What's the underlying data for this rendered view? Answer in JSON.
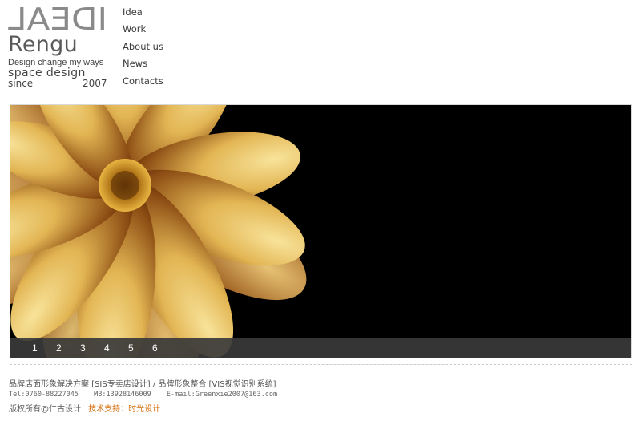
{
  "logo": {
    "ideal": "IDEAL",
    "name": "Rengu",
    "tagline": "Design change my ways",
    "space": "space design",
    "since": "since",
    "year": "2007"
  },
  "nav": {
    "items": [
      "Idea",
      "Work",
      "About us",
      "News",
      "Contacts"
    ]
  },
  "banner": {
    "slides": [
      "1",
      "2",
      "3",
      "4",
      "5",
      "6"
    ]
  },
  "footer": {
    "line1": "品牌店面形象解决方案 [SIS专卖店设计] / 品牌形象整合 [VIS视觉识别系统]",
    "tel": "Tel:0760-88227045",
    "mb": "MB:13928146009",
    "email": "E-mail:Greenxie2007@163.com",
    "copyright": "版权所有@仁古设计",
    "tech": "技术支持：时光设计"
  },
  "colors": {
    "banner_bg": "#000000",
    "slide_bar": "#3a3a3a",
    "tech_link": "#d6700f"
  }
}
